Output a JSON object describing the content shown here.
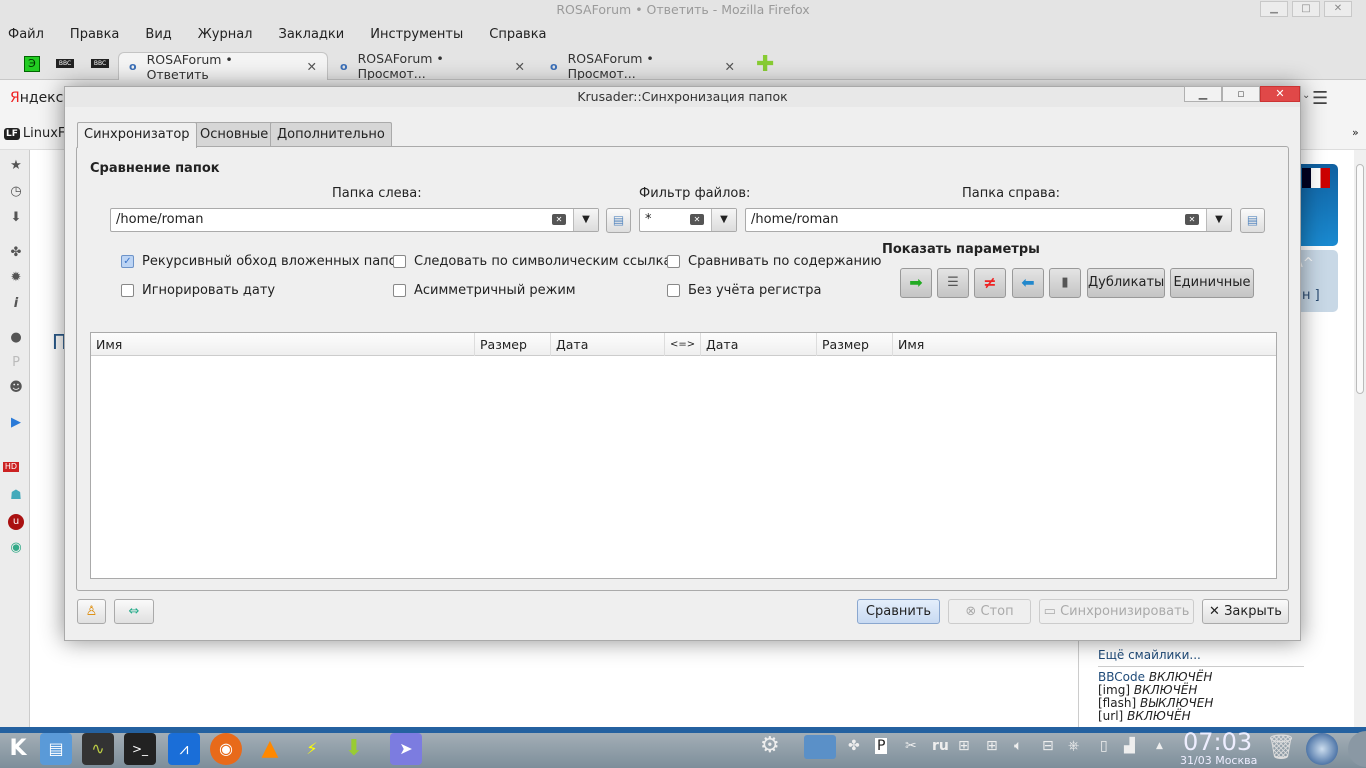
{
  "firefox": {
    "title": "ROSAForum • Ответить - Mozilla Firefox",
    "menu": [
      "Файл",
      "Правка",
      "Вид",
      "Журнал",
      "Закладки",
      "Инструменты",
      "Справка"
    ],
    "tabs": [
      {
        "label": "ROSAForum • Ответить",
        "active": true
      },
      {
        "label": "ROSAForum • Просмот...",
        "active": false
      },
      {
        "label": "ROSAForum • Просмот...",
        "active": false
      }
    ],
    "bbc1": "BBC",
    "bbc2": "BBC",
    "yandex": "Яндекс",
    "bookmark": "LinuxFo",
    "overflow": "»",
    "page": {
      "heading_fragment": "П",
      "link_fragment": "ан ]",
      "font_ctrl": "A^",
      "more_smilies": "Ещё смайлики...",
      "bbcode_label": "BBCode",
      "bbcode_state": "ВКЛЮЧЁН",
      "img_label": "[img]",
      "img_state": "ВКЛЮЧЁН",
      "flash_label": "[flash]",
      "flash_state": "ВЫКЛЮЧЕН",
      "url_label": "[url]",
      "url_state": "ВКЛЮЧЁН"
    }
  },
  "dialog": {
    "title": "Krusader::Синхронизация папок",
    "tabs": [
      "Синхронизатор",
      "Основные",
      "Дополнительно"
    ],
    "group_title": "Сравнение папок",
    "left_label": "Папка слева:",
    "left_value": "/home/roman",
    "filter_label": "Фильтр файлов:",
    "filter_value": "*",
    "right_label": "Папка справа:",
    "right_value": "/home/roman",
    "checkboxes": [
      {
        "label": "Рекурсивный обход вложенных папок",
        "checked": true
      },
      {
        "label": "Следовать по символическим ссылкам",
        "checked": false
      },
      {
        "label": "Сравнивать по содержанию",
        "checked": false
      },
      {
        "label": "Игнорировать дату",
        "checked": false
      },
      {
        "label": "Асимметричный режим",
        "checked": false
      },
      {
        "label": "Без учёта регистра",
        "checked": false
      }
    ],
    "show_params": "Показать параметры",
    "duplicates": "Дубликаты",
    "singles": "Единичные",
    "columns": [
      "Имя",
      "Размер",
      "Дата",
      "<=>",
      "Дата",
      "Размер",
      "Имя"
    ],
    "compare": "Сравнить",
    "stop": "Стоп",
    "synchronize": "Синхронизировать",
    "close": "Закрыть"
  },
  "taskbar": {
    "time": "07:03",
    "date": "31/03 Москва",
    "lang": "ru"
  }
}
